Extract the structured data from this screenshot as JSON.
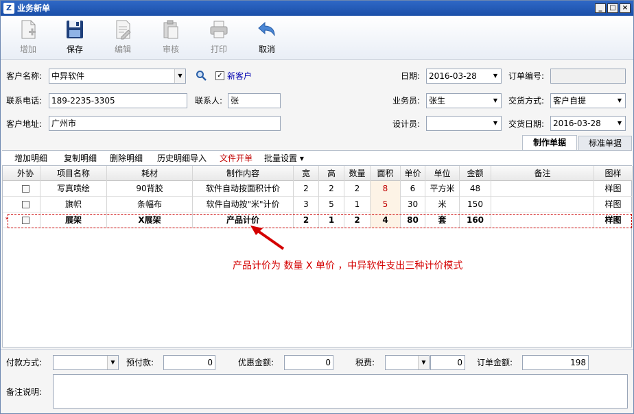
{
  "window": {
    "title": "业务新单",
    "minimize": "_",
    "maximize": "□",
    "close": "×"
  },
  "toolbar": {
    "add": "增加",
    "save": "保存",
    "edit": "编辑",
    "audit": "审核",
    "print": "打印",
    "cancel": "取消"
  },
  "form": {
    "customer_label": "客户名称:",
    "customer_value": "中异软件",
    "new_customer_checked": "✓",
    "new_customer_label": "新客户",
    "phone_label": "联系电话:",
    "phone_value": "189-2235-3305",
    "contact_label": "联系人:",
    "contact_value": "张",
    "address_label": "客户地址:",
    "address_value": "广州市",
    "date_label": "日期:",
    "date_value": "2016-03-28",
    "order_no_label": "订单编号:",
    "order_no_value": "",
    "salesman_label": "业务员:",
    "salesman_value": "张生",
    "delivery_method_label": "交货方式:",
    "delivery_method_value": "客户自提",
    "designer_label": "设计员:",
    "designer_value": "",
    "delivery_date_label": "交货日期:",
    "delivery_date_value": "2016-03-28"
  },
  "tabs": [
    {
      "label": "制作单据"
    },
    {
      "label": "标准单据"
    }
  ],
  "grid_toolbar": {
    "add_detail": "增加明细",
    "copy_detail": "复制明细",
    "delete_detail": "删除明细",
    "history_import": "历史明细导入",
    "file_order": "文件开单",
    "batch_settings": "批量设置 ▾"
  },
  "grid": {
    "columns": [
      "外协",
      "项目名称",
      "耗材",
      "制作内容",
      "宽",
      "高",
      "数量",
      "面积",
      "单价",
      "单位",
      "金额",
      "备注",
      "图样"
    ],
    "rows": [
      {
        "outsource": "",
        "item": "写真喷绘",
        "material": "90背胶",
        "content": "软件自动按面积计价",
        "width": "2",
        "height": "2",
        "qty": "2",
        "area": "8",
        "price": "6",
        "unit": "平方米",
        "amount": "48",
        "note": "",
        "sample": "样图"
      },
      {
        "outsource": "",
        "item": "旗帜",
        "material": "条幅布",
        "content": "软件自动按\"米\"计价",
        "width": "3",
        "height": "5",
        "qty": "1",
        "area": "5",
        "price": "30",
        "unit": "米",
        "amount": "150",
        "note": "",
        "sample": "样图"
      },
      {
        "outsource": "",
        "item": "展架",
        "material": "X展架",
        "content": "产品计价",
        "width": "2",
        "height": "1",
        "qty": "2",
        "area": "4",
        "price": "80",
        "unit": "套",
        "amount": "160",
        "note": "",
        "sample": "样图"
      }
    ],
    "current_row_marker": "*"
  },
  "annotation": "产品计价为 数量 X 单价 ，中异软件支出三种计价模式",
  "footer": {
    "payment_method_label": "付款方式:",
    "payment_method_value": "",
    "prepaid_label": "预付款:",
    "prepaid_value": "0",
    "discount_label": "优惠金额:",
    "discount_value": "0",
    "tax_label": "税费:",
    "tax_type_value": "",
    "tax_value": "0",
    "order_amount_label": "订单金额:",
    "order_amount_value": "198",
    "memo_label": "备注说明:",
    "memo_value": ""
  },
  "colors": {
    "title_bar": "#1b4fa8",
    "accent_red": "#c00000",
    "annotation_red": "#d40000"
  }
}
